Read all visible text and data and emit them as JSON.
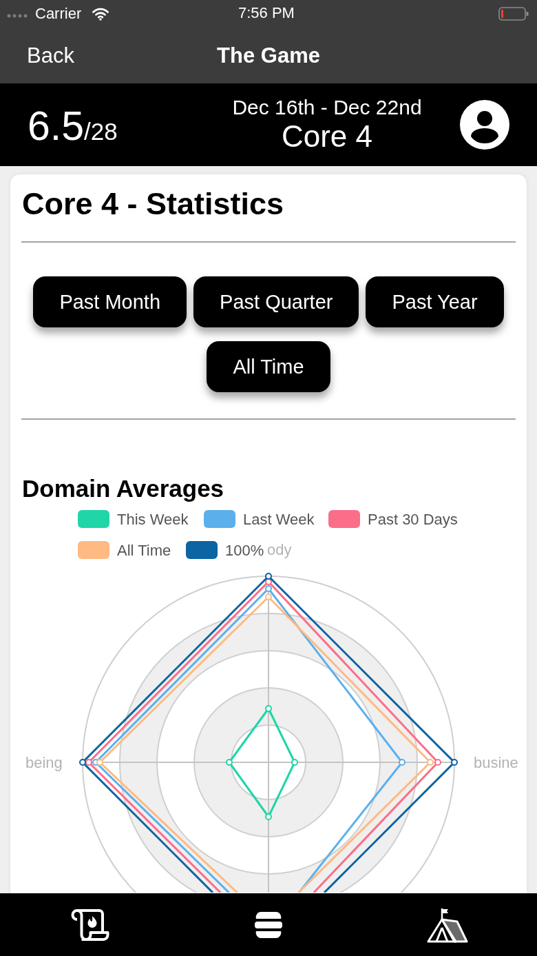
{
  "status_bar": {
    "carrier": "Carrier",
    "time": "7:56 PM"
  },
  "nav_bar": {
    "back_button": "Back",
    "title": "The Game"
  },
  "header": {
    "score": "6.5",
    "score_total": "/28",
    "date_range": "Dec 16th - Dec 22nd",
    "title": "Core 4"
  },
  "statistics": {
    "title": "Core 4 - Statistics",
    "period_buttons": [
      "Past Month",
      "Past Quarter",
      "Past Year",
      "All Time"
    ]
  },
  "domain_averages": {
    "title": "Domain Averages",
    "legend": [
      {
        "label": "This Week",
        "color": "#20d5a8"
      },
      {
        "label": "Last Week",
        "color": "#5bb0ec"
      },
      {
        "label": "Past 30 Days",
        "color": "#fb6e8a"
      },
      {
        "label": "All Time",
        "color": "#ffb983"
      },
      {
        "label": "100%",
        "color": "#0b64a3"
      }
    ],
    "axis_labels": [
      "ody",
      "being",
      "busine"
    ]
  }
}
